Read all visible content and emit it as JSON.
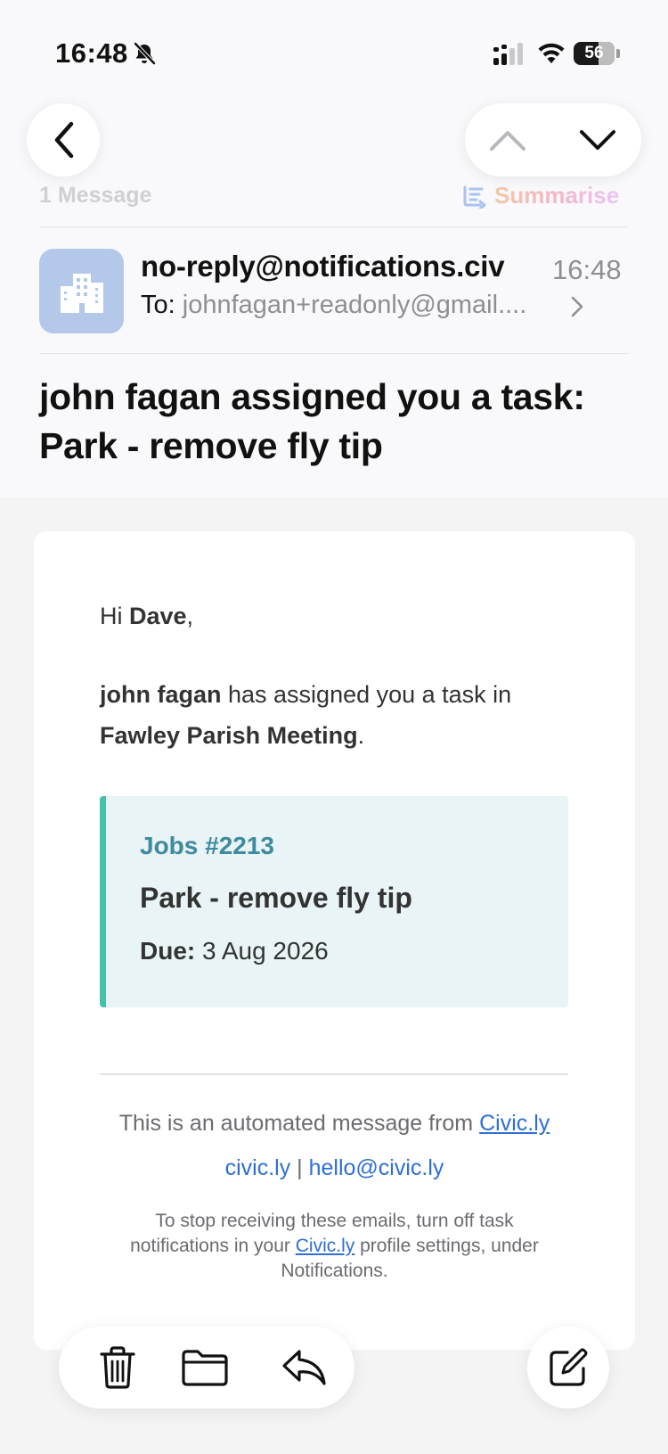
{
  "status_bar": {
    "time": "16:48",
    "battery": "56",
    "icons": [
      "bell-slash-icon",
      "signal-icon",
      "wifi-icon",
      "battery-icon"
    ]
  },
  "nav": {
    "icons": [
      "chevron-left-icon",
      "chevron-up-icon",
      "chevron-down-icon"
    ]
  },
  "thread": {
    "message_count": "1 Message",
    "summarise_label": "Summarise"
  },
  "header": {
    "sender": "no-reply@notifications.civ",
    "time": "16:48",
    "to_label": "To:",
    "to_value": "johnfagan+readonly@gmail....",
    "subject": "john fagan assigned you a task: Park - remove fly tip"
  },
  "body": {
    "greeting_prefix": "Hi ",
    "greeting_name": "Dave",
    "greeting_suffix": ",",
    "assigner": "john fagan",
    "assigned_text": " has assigned you a task in ",
    "organisation": "Fawley Parish Meeting",
    "period": ".",
    "task": {
      "id": "Jobs #2213",
      "title": "Park - remove fly tip",
      "due_label": "Due:",
      "due_value": " 3 Aug 2026"
    },
    "footer": {
      "automated_text": "This is an automated message from ",
      "automated_link": "Civic.ly",
      "site_link": "civic.ly",
      "separator": " | ",
      "email_link": "hello@civic.ly",
      "note_prefix": "To stop receiving these emails, turn off task notifications in your ",
      "note_link": "Civic.ly",
      "note_suffix": " profile settings, under Notifications."
    }
  },
  "toolbar": {
    "icons": [
      "trash-icon",
      "folder-icon",
      "reply-icon",
      "compose-icon"
    ]
  }
}
